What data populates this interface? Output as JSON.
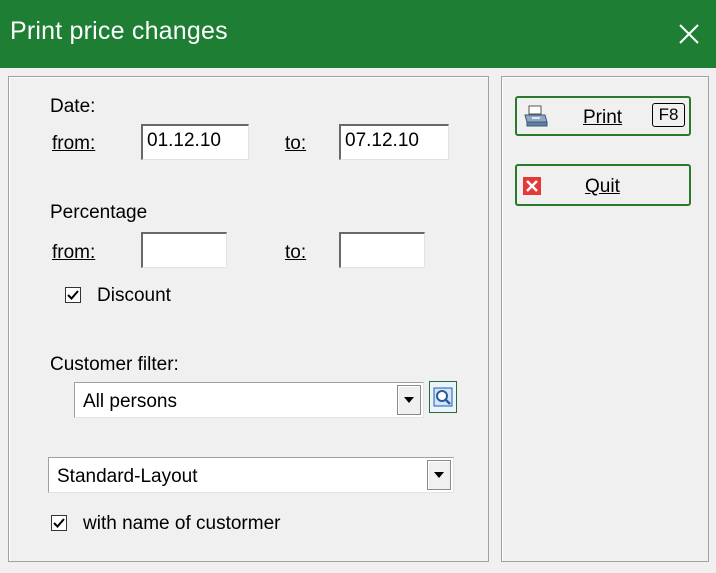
{
  "window": {
    "title": "Print price changes"
  },
  "date": {
    "label": "Date:",
    "from_label": "from:",
    "from_value": "01.12.10",
    "to_label": "to:",
    "to_value": "07.12.10"
  },
  "percentage": {
    "label": "Percentage",
    "from_label": "from:",
    "from_value": "",
    "to_label": "to:",
    "to_value": "",
    "discount_label": "Discount",
    "discount_checked": true
  },
  "customer_filter": {
    "label": "Customer filter:",
    "selected": "All persons"
  },
  "layout": {
    "selected": "Standard-Layout",
    "with_name_label": "with name of custormer",
    "with_name_checked": true
  },
  "buttons": {
    "print_label": "Print",
    "print_key": "F8",
    "quit_label": "Quit"
  },
  "colors": {
    "titlebar": "#1e7e34",
    "button_border": "#2b7a2b"
  }
}
